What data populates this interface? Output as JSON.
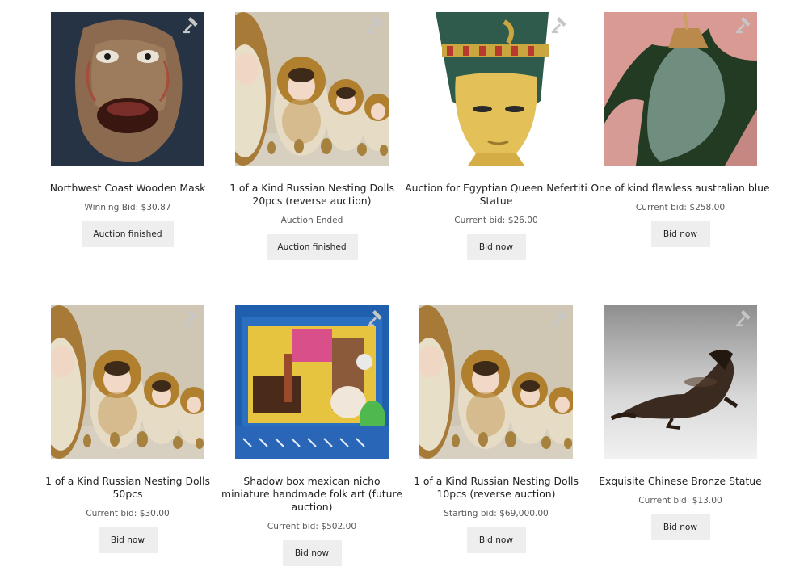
{
  "products": [
    {
      "title": "Northwest Coast Wooden Mask",
      "price": "Winning Bid: $30.87",
      "button": "Auction finished"
    },
    {
      "title": "1 of a Kind Russian Nesting Dolls 20pcs (reverse auction)",
      "price": "Auction Ended",
      "button": "Auction finished"
    },
    {
      "title": "Auction for Egyptian Queen Nefertiti Statue",
      "price": "Current bid: $26.00",
      "button": "Bid now"
    },
    {
      "title": "One of kind flawless australian blue",
      "price": "Current bid: $258.00",
      "button": "Bid now"
    },
    {
      "title": "1 of a Kind Russian Nesting Dolls 50pcs",
      "price": "Current bid: $30.00",
      "button": "Bid now"
    },
    {
      "title": "Shadow box mexican nicho miniature handmade folk art (future auction)",
      "price": "Current bid: $502.00",
      "button": "Bid now"
    },
    {
      "title": "1 of a Kind Russian Nesting Dolls 10pcs (reverse auction)",
      "price": "Starting bid: $69,000.00",
      "button": "Bid now"
    },
    {
      "title": "Exquisite Chinese Bronze Statue",
      "price": "Current bid: $13.00",
      "button": "Bid now"
    }
  ],
  "icons": {
    "auction": "gavel-icon"
  },
  "colors": {
    "button_bg": "#eeeeee",
    "text": "#222222",
    "muted": "#5a5a5a",
    "gavel": "#c8c8c8"
  }
}
